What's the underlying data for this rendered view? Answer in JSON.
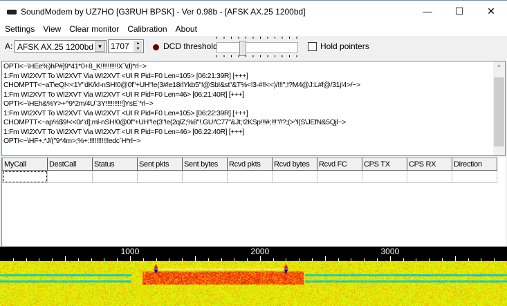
{
  "window": {
    "title": "SoundModem by UZ7HO [G3RUH BPSK] - Ver 0.98b - [AFSK AX.25 1200bd]",
    "minimize": "—",
    "maximize": "☐",
    "close": "✕"
  },
  "menu": [
    "Settings",
    "View",
    "Clear monitor",
    "Calibration",
    "About"
  ],
  "toolbar": {
    "channel_label": "A:",
    "mode": "AFSK AX.25 1200bd",
    "frequency": "1707",
    "dcd_label": "DCD threshold",
    "dcd_level": 0.3,
    "hold_pointers_label": "Hold pointers",
    "hold_pointers_checked": false,
    "led_color": "#6b0000"
  },
  "monitor": {
    "lines": [
      "OPTI<~\\HEe%)hP#]9*41*0+8_K!!!!!!!!!!X`\\d)*rl~>",
      "1:Fm WI2XVT To WI2XVT Via WI2XVT <UI R Pid=F0 Len=105> [06:21:39R] [+++]",
      "CHOMPTT<~aT\\eQ!<<1Y\"dK/k!-nSH!0@0f\"+UH\"!e(3#!e18rlYkb5\"!@Sb!&st\"&T%<!3-#!!<<)/!!!\";!?M4@J:L#f@/31j!4>/~>",
      "1:Fm WI2XVT To WI2XVT Via WI2XVT <UI R Pid=F0 Len=46> [06:21:40R] [+++]",
      "OPTI<~\\HEh&%Y>+^9*2m/4U`3Y!!!!!!!!!!]YsE`*rl~>",
      "1:Fm WI2XVT To WI2XVT Via WI2XVT <UI R Pid=F0 Len=105> [06:22:39R] [+++]",
      "CHOMPTT<~ap%$9!<<0r\"d];ml-nSH!0@0f\"+UH\"!e(3\"!e(2qlZ;%8\"!.GU!'C77\"&Jt;!2KSp!!!#;!!!\"/!?;(>^l(S\\JEfN&5Qjl~>",
      "1:Fm WI2XVT To WI2XVT Via WI2XVT <UI R Pid=F0 Len=46> [06:22:40R] [+++]",
      "OPTI<~\\HF+.*J/(\"9*4m>;%+:!!!!!!!!!!!edc`H*rl~>"
    ]
  },
  "table": {
    "columns": [
      "MyCall",
      "DestCall",
      "Status",
      "Sent pkts",
      "Sent bytes",
      "Rcvd pkts",
      "Rcvd bytes",
      "Rcvd FC",
      "CPS TX",
      "CPS RX",
      "Direction"
    ]
  },
  "waterfall": {
    "scale_labels": [
      "1000",
      "2000",
      "3000"
    ],
    "max_hz": 3900,
    "marker_low_hz": 1200,
    "marker_high_hz": 2200
  }
}
